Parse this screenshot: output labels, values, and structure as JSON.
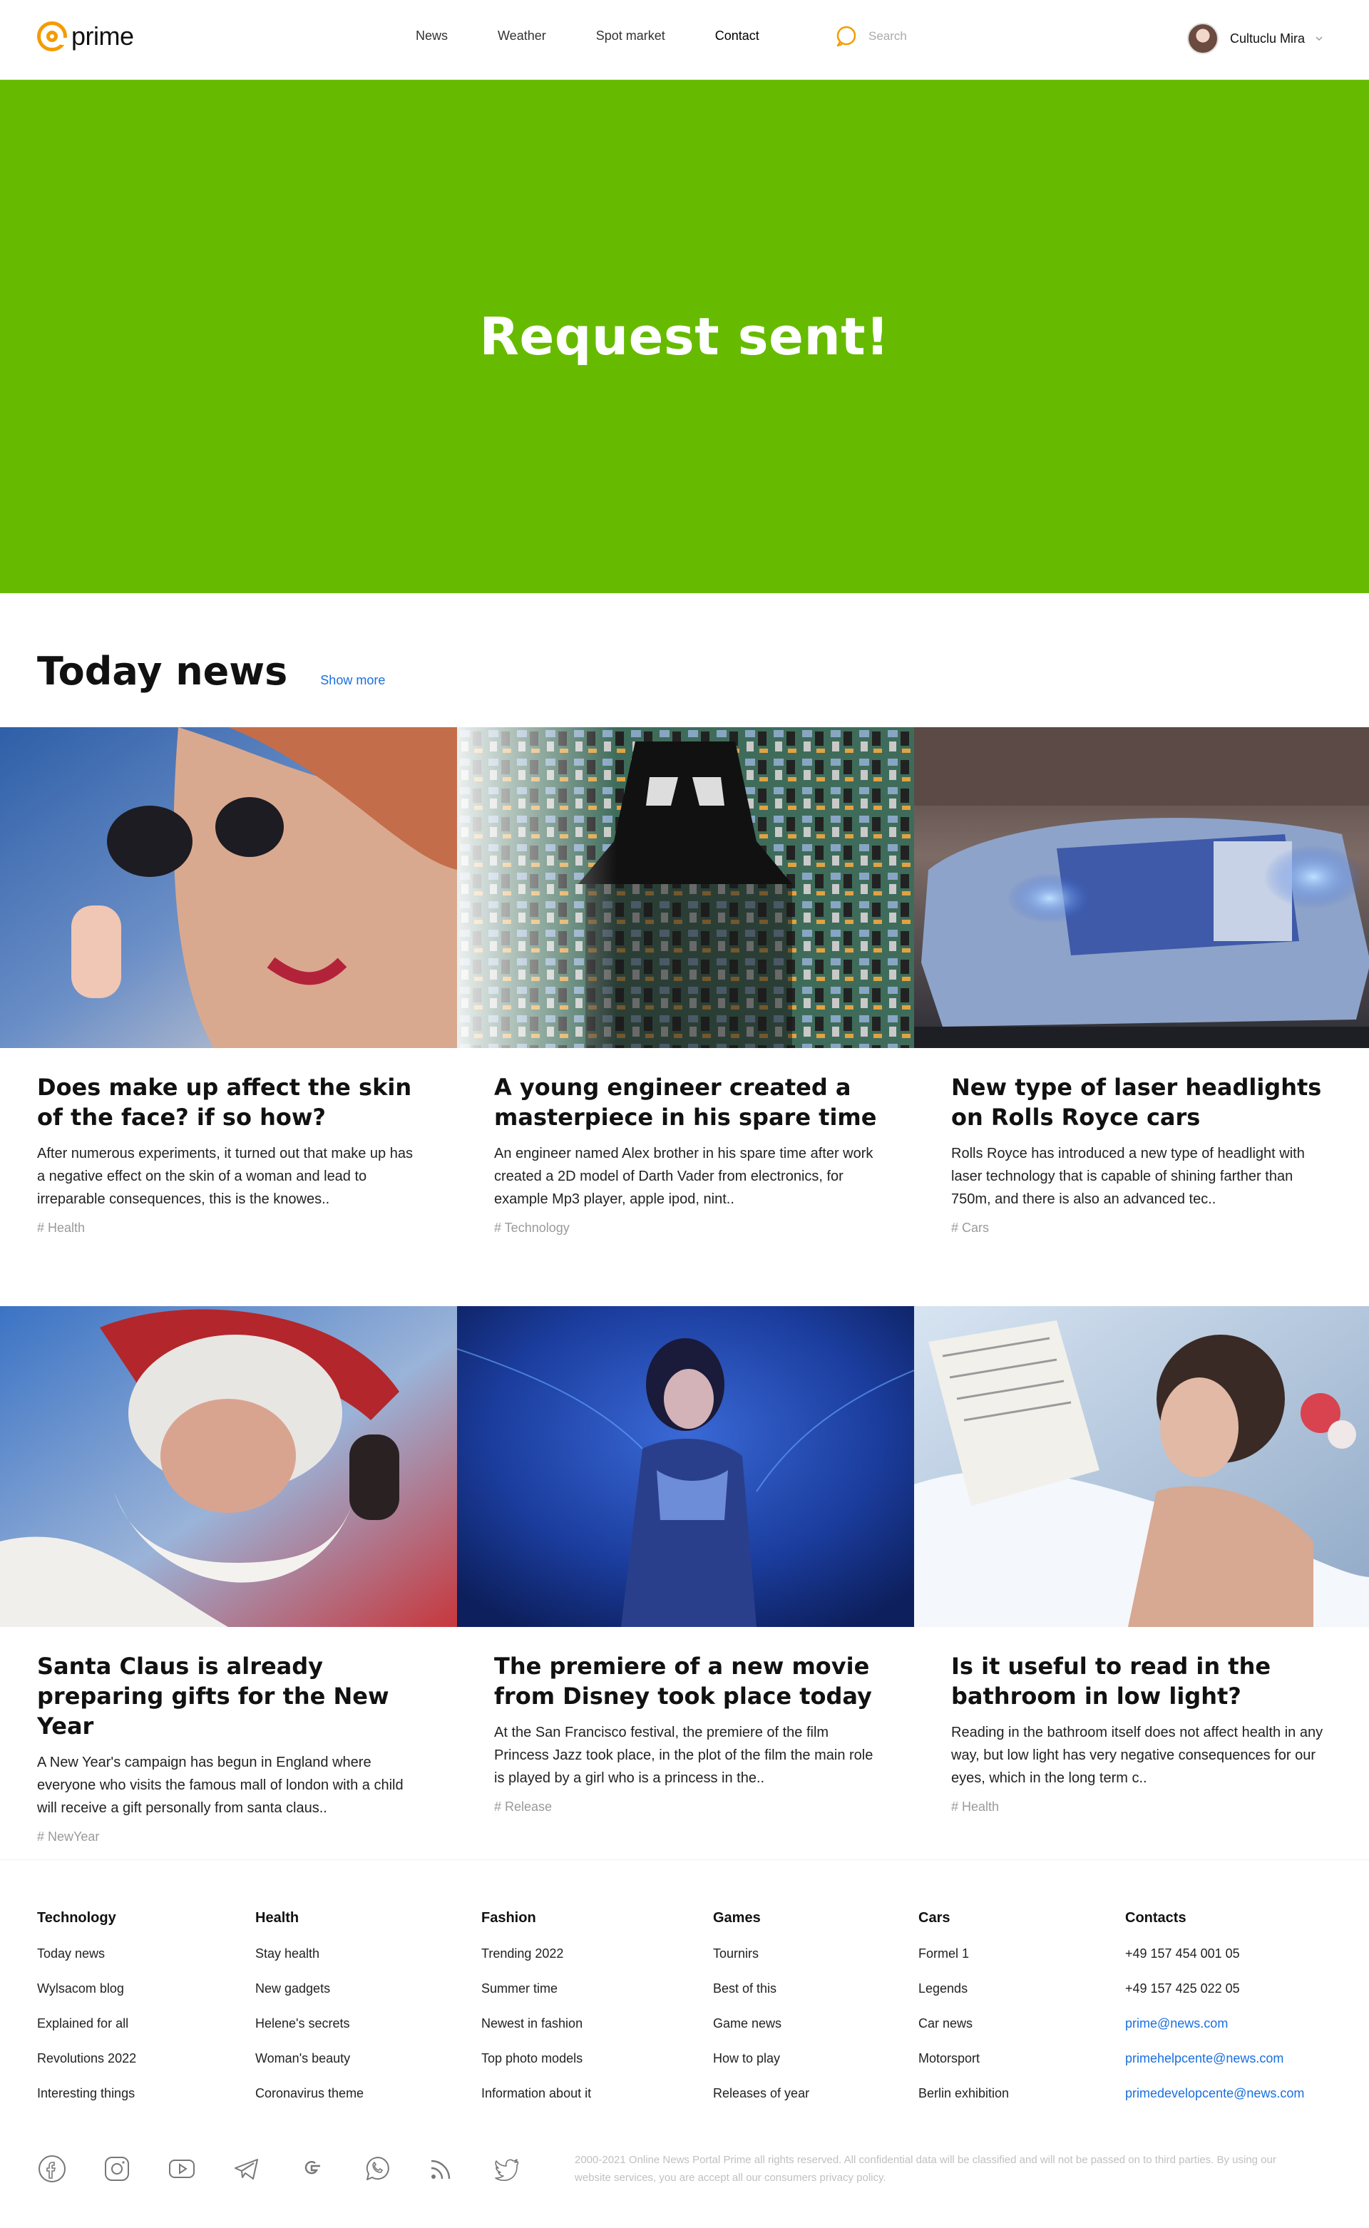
{
  "header": {
    "logo_text": "prime",
    "nav": [
      "News",
      "Weather",
      "Spot market",
      "Contact"
    ],
    "search_placeholder": "Search",
    "user_name": "Cultuclu Mira"
  },
  "hero": {
    "title": "Request sent!"
  },
  "today": {
    "title": "Today news",
    "show_more": "Show more",
    "cards": [
      {
        "title": "Does make up affect the skin of the face? if so how?",
        "desc": "After numerous experiments, it turned out that make up has a negative effect on the skin of a woman and lead to irreparable consequences, this is the knowes..",
        "tag": "# Health"
      },
      {
        "title": "A young engineer created a masterpiece in his spare time",
        "desc": "An engineer named Alex brother in his spare time after work created a 2D model of Darth Vader from electronics, for example Mp3 player, apple ipod, nint..",
        "tag": "# Technology"
      },
      {
        "title": "New type of laser headlights on Rolls Royce cars",
        "desc": "Rolls Royce has introduced a new type of headlight with laser technology that is capable of shining farther than 750m, and there is also an advanced tec..",
        "tag": "# Cars"
      },
      {
        "title": "Santa Claus is already preparing gifts for the New Year",
        "desc": "A New Year's campaign has begun in England where everyone who visits the famous mall of london with a child will receive a gift personally from santa claus..",
        "tag": "# NewYear"
      },
      {
        "title": "The premiere of a new movie from Disney took place today",
        "desc": "At the San Francisco festival, the premiere of the film Princess Jazz took place, in the plot of the film the main role is played by a girl who is a princess in the..",
        "tag": "# Release"
      },
      {
        "title": "Is it useful to read in the bathroom in low light?",
        "desc": "Reading in the bathroom itself does not affect health in any way, but low light has very negative consequences for our eyes, which in the long term c..",
        "tag": "# Health"
      }
    ]
  },
  "footer": {
    "columns": [
      {
        "title": "Technology",
        "links": [
          "Today news",
          "Wylsacom blog",
          "Explained for all",
          "Revolutions 2022",
          "Interesting things"
        ]
      },
      {
        "title": "Health",
        "links": [
          "Stay health",
          "New gadgets",
          "Helene's secrets",
          "Woman's beauty",
          "Coronavirus theme"
        ]
      },
      {
        "title": "Fashion",
        "links": [
          "Trending 2022",
          "Summer time",
          "Newest in fashion",
          "Top photo models",
          "Information about it"
        ]
      },
      {
        "title": "Games",
        "links": [
          "Tournirs",
          "Best of this",
          "Game news",
          "How to play",
          "Releases of year"
        ]
      },
      {
        "title": "Cars",
        "links": [
          "Formel 1",
          "Legends",
          "Car news",
          "Motorsport",
          "Berlin exhibition"
        ]
      },
      {
        "title": "Contacts",
        "links": [
          "+49 157 454 001 05",
          "+49 157 425 022 05",
          "prime@news.com",
          "primehelpcente@news.com",
          "primedevelopcente@news.com"
        ]
      }
    ],
    "socials": [
      "facebook-icon",
      "instagram-icon",
      "youtube-icon",
      "telegram-icon",
      "google-icon",
      "whatsapp-icon",
      "rss-icon",
      "twitter-icon"
    ],
    "copyright": "2000-2021 Online News Portal Prime all rights reserved. All confidential data will be classified and will not be passed on to third parties. By using our website services, you are accept all our consumers privacy policy."
  },
  "colors": {
    "accent": "#f59b00",
    "hero_bg": "#66bb00",
    "link": "#1a6fe0"
  }
}
